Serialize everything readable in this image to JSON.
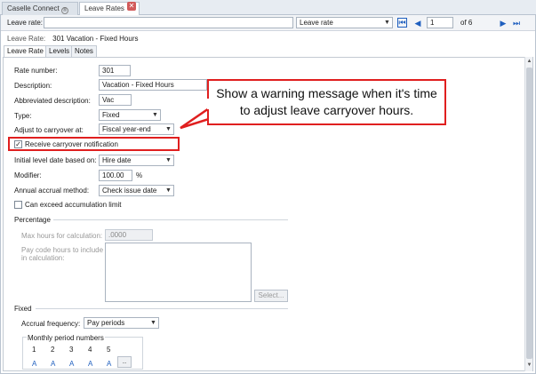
{
  "tabs": [
    {
      "label": "Caselle Connect",
      "pinned": true
    },
    {
      "label": "Leave Rates",
      "closable": true
    }
  ],
  "topbar": {
    "leave_rate_label": "Leave rate:",
    "leave_rate_value": "",
    "leave_rate_dropdown": "Leave rate",
    "record_number": "1",
    "record_total": "of 6"
  },
  "info": {
    "label": "Leave Rate:",
    "value": "301  Vacation - Fixed Hours"
  },
  "inner_tabs": [
    "Leave Rate",
    "Levels",
    "Notes"
  ],
  "form": {
    "rate_number": {
      "label": "Rate number:",
      "value": "301"
    },
    "description": {
      "label": "Description:",
      "value": "Vacation - Fixed Hours"
    },
    "abbreviated": {
      "label": "Abbreviated description:",
      "value": "Vac"
    },
    "type": {
      "label": "Type:",
      "value": "Fixed"
    },
    "adjust": {
      "label": "Adjust to carryover at:",
      "value": "Fiscal year-end"
    },
    "receive_notification": {
      "label": "Receive carryover notification",
      "checked": true
    },
    "initial_level": {
      "label": "Initial level date based on:",
      "value": "Hire date"
    },
    "modifier": {
      "label": "Modifier:",
      "value": "100.00",
      "unit": "%"
    },
    "annual_accrual": {
      "label": "Annual accrual method:",
      "value": "Check issue date"
    },
    "exceed_limit": {
      "label": "Can exceed accumulation limit",
      "checked": false
    }
  },
  "percentage": {
    "title": "Percentage",
    "max_hours_label": "Max hours for calculation:",
    "max_hours_value": ".0000",
    "pay_code_label_1": "Pay code hours to include",
    "pay_code_label_2": "in calculation:",
    "select_button": "Select..."
  },
  "fixed": {
    "title": "Fixed",
    "accrual_label": "Accrual frequency:",
    "accrual_value": "Pay periods",
    "monthly_label": "Monthly period numbers",
    "period_numbers": [
      "1",
      "2",
      "3",
      "4",
      "5"
    ],
    "period_values": [
      "A",
      "A",
      "A",
      "A",
      "A"
    ],
    "more_button": ".."
  },
  "annotation": {
    "line1": "Show a warning message when it's time",
    "line2": "to adjust leave carryover hours."
  },
  "colors": {
    "annotation_red": "#e01f1f",
    "nav_blue": "#1f5fbf"
  }
}
